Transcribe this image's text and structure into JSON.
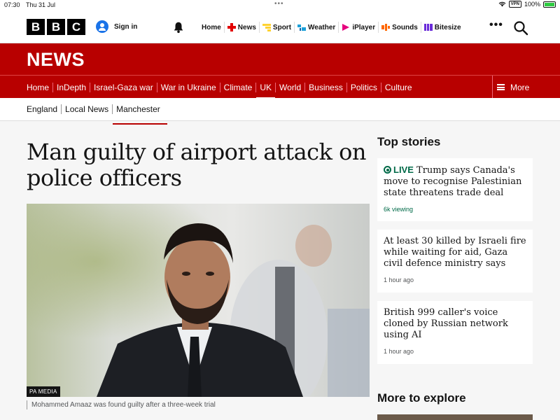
{
  "status_bar": {
    "time": "07:30",
    "date": "Thu 31 Jul",
    "vpn": "VPN",
    "battery": "100%"
  },
  "top_nav": {
    "logo_letters": [
      "B",
      "B",
      "C"
    ],
    "sign_in": "Sign in",
    "links": [
      {
        "label": "Home",
        "icon": "none"
      },
      {
        "label": "News",
        "icon": "news-icon"
      },
      {
        "label": "Sport",
        "icon": "sport-icon"
      },
      {
        "label": "Weather",
        "icon": "weather-icon"
      },
      {
        "label": "iPlayer",
        "icon": "iplayer-icon"
      },
      {
        "label": "Sounds",
        "icon": "sounds-icon"
      },
      {
        "label": "Bitesize",
        "icon": "bitesize-icon"
      }
    ],
    "more": "•••"
  },
  "banner": {
    "title": "NEWS"
  },
  "section_nav": {
    "items": [
      "Home",
      "InDepth",
      "Israel-Gaza war",
      "War in Ukraine",
      "Climate",
      "UK",
      "World",
      "Business",
      "Politics",
      "Culture"
    ],
    "active": "UK",
    "more_label": "More"
  },
  "sub_nav": {
    "items": [
      "England",
      "Local News",
      "Manchester"
    ],
    "active": "Manchester"
  },
  "article": {
    "headline": "Man guilty of airport attack on police officers",
    "image_credit": "PA MEDIA",
    "caption": "Mohammed Amaaz was found guilty after a three-week trial"
  },
  "sidebar": {
    "top_stories_title": "Top stories",
    "stories": [
      {
        "live": "LIVE",
        "title": "Trump says Canada's move to recognise Palestinian state threatens trade deal",
        "meta": "6k viewing"
      },
      {
        "title": "At least 30 killed by Israeli fire while waiting for aid, Gaza civil defence ministry says",
        "meta": "1 hour ago"
      },
      {
        "title": "British 999 caller's voice cloned by Russian network using AI",
        "meta": "1 hour ago"
      }
    ],
    "more_to_explore_title": "More to explore"
  },
  "colors": {
    "brand_red": "#b80000",
    "live_green": "#006a48"
  }
}
